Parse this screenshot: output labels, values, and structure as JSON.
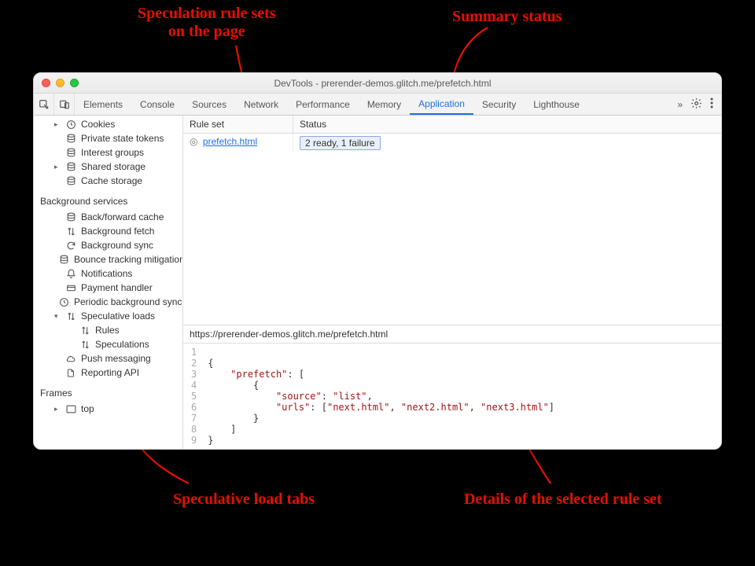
{
  "annotations": {
    "rule_sets": "Speculation rule sets\non the page",
    "summary_status": "Summary status",
    "load_tabs": "Speculative load tabs",
    "details": "Details of the selected rule set"
  },
  "window": {
    "title": "DevTools - prerender-demos.glitch.me/prefetch.html"
  },
  "tabbar": {
    "tabs": [
      "Elements",
      "Console",
      "Sources",
      "Network",
      "Performance",
      "Memory",
      "Application",
      "Security",
      "Lighthouse"
    ],
    "active": "Application",
    "more": "»"
  },
  "sidebar": {
    "storage_items": [
      {
        "icon": "clock",
        "label": "Cookies",
        "expandable": true
      },
      {
        "icon": "db",
        "label": "Private state tokens"
      },
      {
        "icon": "db",
        "label": "Interest groups"
      },
      {
        "icon": "db",
        "label": "Shared storage",
        "expandable": true
      },
      {
        "icon": "db",
        "label": "Cache storage"
      }
    ],
    "bg_title": "Background services",
    "bg_items": [
      {
        "icon": "db",
        "label": "Back/forward cache"
      },
      {
        "icon": "updown",
        "label": "Background fetch"
      },
      {
        "icon": "sync",
        "label": "Background sync"
      },
      {
        "icon": "db",
        "label": "Bounce tracking mitigations"
      },
      {
        "icon": "bell",
        "label": "Notifications"
      },
      {
        "icon": "card",
        "label": "Payment handler"
      },
      {
        "icon": "clock",
        "label": "Periodic background sync"
      }
    ],
    "spec_label": "Speculative loads",
    "spec_children": [
      {
        "icon": "updown",
        "label": "Rules"
      },
      {
        "icon": "updown",
        "label": "Speculations"
      }
    ],
    "after_items": [
      {
        "icon": "cloud",
        "label": "Push messaging"
      },
      {
        "icon": "doc",
        "label": "Reporting API"
      }
    ],
    "frames_title": "Frames",
    "frames_items": [
      {
        "icon": "frame",
        "label": "top",
        "expandable": true
      }
    ]
  },
  "main": {
    "columns": {
      "ruleset": "Rule set",
      "status": "Status"
    },
    "rows": [
      {
        "ruleset": "prefetch.html",
        "status": "2 ready, 1 failure"
      }
    ],
    "url": "https://prerender-demos.glitch.me/prefetch.html",
    "code": {
      "lines": [
        "1",
        "2",
        "3",
        "4",
        "5",
        "6",
        "7",
        "8",
        "9"
      ],
      "pretty": "\n{\n    \"prefetch\": [\n        {\n            \"source\": \"list\",\n            \"urls\": [\"next.html\", \"next2.html\", \"next3.html\"]\n        }\n    ]\n}"
    }
  }
}
